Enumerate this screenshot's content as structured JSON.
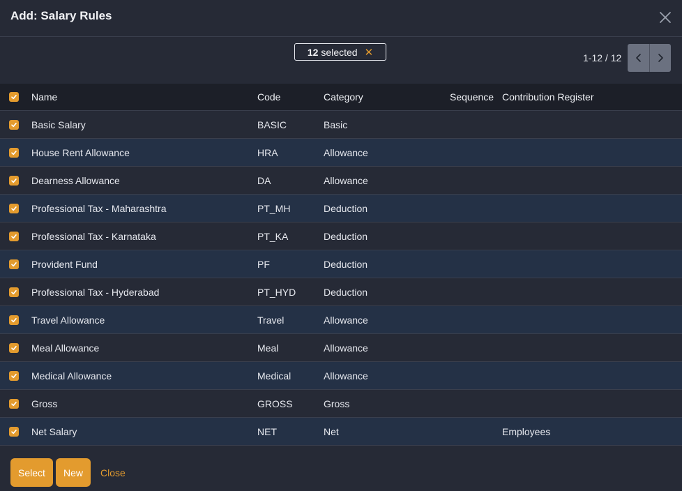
{
  "dialog": {
    "title": "Add: Salary Rules"
  },
  "selection": {
    "count": "12",
    "label": "selected",
    "clear_icon": "✕"
  },
  "pager": {
    "range": "1-12 / 12"
  },
  "table": {
    "columns": {
      "name": "Name",
      "code": "Code",
      "category": "Category",
      "sequence": "Sequence",
      "register": "Contribution Register"
    },
    "rows": [
      {
        "name": "Basic Salary",
        "code": "BASIC",
        "category": "Basic",
        "sequence": "",
        "register": ""
      },
      {
        "name": "House Rent Allowance",
        "code": "HRA",
        "category": "Allowance",
        "sequence": "",
        "register": ""
      },
      {
        "name": "Dearness Allowance",
        "code": "DA",
        "category": "Allowance",
        "sequence": "",
        "register": ""
      },
      {
        "name": "Professional Tax - Maharashtra",
        "code": "PT_MH",
        "category": "Deduction",
        "sequence": "",
        "register": ""
      },
      {
        "name": "Professional Tax - Karnataka",
        "code": "PT_KA",
        "category": "Deduction",
        "sequence": "",
        "register": ""
      },
      {
        "name": "Provident Fund",
        "code": "PF",
        "category": "Deduction",
        "sequence": "",
        "register": ""
      },
      {
        "name": "Professional Tax - Hyderabad",
        "code": "PT_HYD",
        "category": "Deduction",
        "sequence": "",
        "register": ""
      },
      {
        "name": "Travel Allowance",
        "code": "Travel",
        "category": "Allowance",
        "sequence": "",
        "register": ""
      },
      {
        "name": "Meal Allowance",
        "code": "Meal",
        "category": "Allowance",
        "sequence": "",
        "register": ""
      },
      {
        "name": "Medical Allowance",
        "code": "Medical",
        "category": "Allowance",
        "sequence": "",
        "register": ""
      },
      {
        "name": "Gross",
        "code": "GROSS",
        "category": "Gross",
        "sequence": "",
        "register": ""
      },
      {
        "name": "Net Salary",
        "code": "NET",
        "category": "Net",
        "sequence": "",
        "register": "Employees"
      }
    ]
  },
  "footer": {
    "select_label": "Select",
    "new_label": "New",
    "close_label": "Close"
  },
  "colors": {
    "accent": "#e39b2e",
    "background": "#262a36",
    "row_alt": "#243146",
    "header_bg": "#1c1f28"
  },
  "icons": {
    "close": "close-icon",
    "prev": "chevron-left-icon",
    "next": "chevron-right-icon",
    "check": "check-icon"
  }
}
